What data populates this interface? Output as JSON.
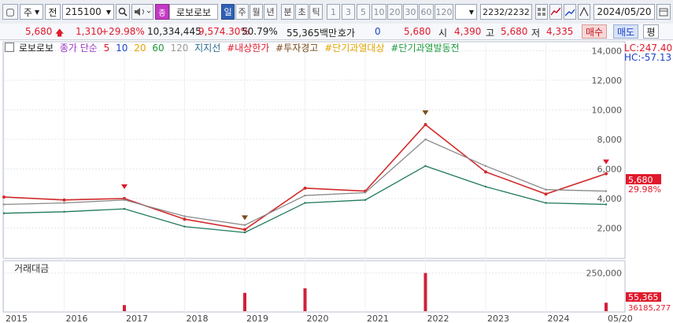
{
  "toolbar": {
    "market_select": "주",
    "type_select": "전",
    "code": "215100",
    "stock_name": "로보로보",
    "stock_badge": "종",
    "periods": [
      "일",
      "주",
      "월",
      "년",
      "분",
      "초",
      "틱"
    ],
    "active_period": "일",
    "intervals": [
      "1",
      "3",
      "5",
      "10",
      "20",
      "30",
      "60",
      "120"
    ],
    "count_display": "2232/2232",
    "date": "2024/05/20"
  },
  "quote": {
    "price": "5,680",
    "change": "1,310",
    "change_rate": "+29.98%",
    "volume": "10,334,445",
    "volume_rate": "9,574.30%",
    "turnover": "50.79%",
    "amount": "55,365백만",
    "ask_label": "호가",
    "ask_value": "0",
    "ask_price": "5,680",
    "open_label": "시",
    "open": "4,390",
    "high_label": "고",
    "high": "5,680",
    "low_label": "저",
    "low": "4,335",
    "buy_label": "매수",
    "sell_label": "매도",
    "eval_label": "평"
  },
  "legend": {
    "name": "로보로보",
    "ma_label": "종가 단순",
    "ma_periods": [
      "5",
      "10",
      "20",
      "60",
      "120"
    ],
    "ma_colors": [
      "#e0192c",
      "#1b44c8",
      "#e3a400",
      "#1a9a3c",
      "#9c9c9c"
    ],
    "support_line": "지지선",
    "items": [
      "#내상한가",
      "#투자경고",
      "#단기과열대상",
      "#단기과열발동전"
    ],
    "item_colors": [
      "#e0192c",
      "#7a4b1b",
      "#e3a400",
      "#1a9a3c"
    ]
  },
  "price_panel": {
    "lc_label": "LC:247.40",
    "hc_label": "HC:-57.13",
    "current_price_tag": "5,680",
    "current_rate_tag": "29.98%",
    "y_ticks": [
      "14,000",
      "12,000",
      "10,000",
      "8,000",
      "6,000",
      "4,000",
      "2,000"
    ]
  },
  "volume_panel": {
    "title": "거래대금",
    "y_ticks": [
      "250,000"
    ],
    "value_tag": "55,365",
    "total_tag": "36185,277"
  },
  "x_axis": {
    "labels": [
      "2015",
      "2016",
      "2017",
      "2018",
      "2019",
      "2020",
      "2021",
      "2022",
      "2023",
      "2024",
      "05/20"
    ]
  },
  "chart_data": {
    "type": "line",
    "title": "로보로보",
    "ylabel": "",
    "ylim": [
      0,
      14500
    ],
    "x": [
      "2015",
      "2016",
      "2017",
      "2018",
      "2019",
      "2020",
      "2021",
      "2022",
      "2023",
      "2024",
      "2024-05"
    ],
    "series": [
      {
        "name": "로보로보",
        "values": [
          4100,
          3900,
          4000,
          2600,
          1900,
          4700,
          4500,
          9000,
          5800,
          4300,
          5680
        ]
      },
      {
        "name": "120",
        "values": [
          3600,
          3700,
          3900,
          2800,
          2200,
          4200,
          4400,
          8000,
          6200,
          4600,
          4500
        ]
      },
      {
        "name": "60",
        "values": [
          3000,
          3100,
          3300,
          2100,
          1700,
          3700,
          3900,
          6200,
          4800,
          3700,
          3600
        ]
      }
    ],
    "volume": {
      "title": "거래대금",
      "ylim": [
        0,
        320000
      ],
      "peaks": [
        {
          "x": "2017",
          "value": 40000
        },
        {
          "x": "2019",
          "value": 120000
        },
        {
          "x": "2020",
          "value": 150000
        },
        {
          "x": "2022",
          "value": 250000
        },
        {
          "x": "2024-05",
          "value": 55365
        }
      ]
    }
  }
}
